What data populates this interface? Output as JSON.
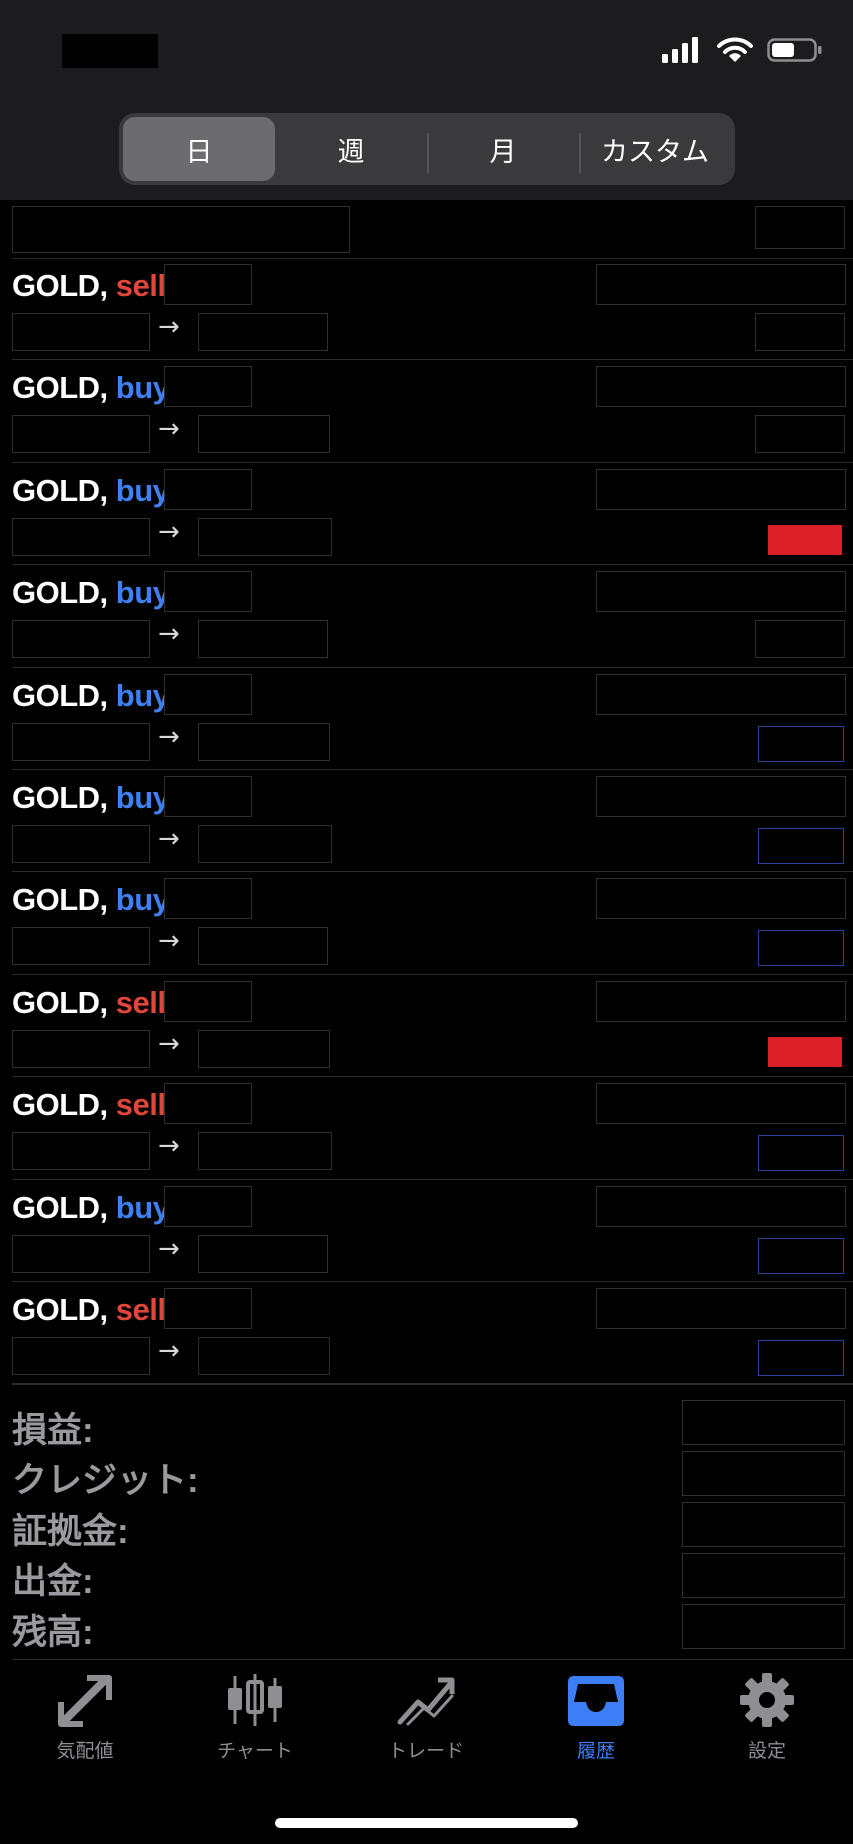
{
  "segmented": {
    "options": [
      "日",
      "週",
      "月",
      "カスタム"
    ],
    "selected": "日"
  },
  "trades": [
    {
      "symbol": "GOLD,",
      "side": "sell",
      "profit_indicator": "neutral"
    },
    {
      "symbol": "GOLD,",
      "side": "buy",
      "profit_indicator": "neutral"
    },
    {
      "symbol": "GOLD,",
      "side": "buy",
      "profit_indicator": "red"
    },
    {
      "symbol": "GOLD,",
      "side": "buy",
      "profit_indicator": "neutral"
    },
    {
      "symbol": "GOLD,",
      "side": "buy",
      "profit_indicator": "blue"
    },
    {
      "symbol": "GOLD,",
      "side": "buy",
      "profit_indicator": "blue"
    },
    {
      "symbol": "GOLD,",
      "side": "buy",
      "profit_indicator": "blue"
    },
    {
      "symbol": "GOLD,",
      "side": "sell",
      "profit_indicator": "red"
    },
    {
      "symbol": "GOLD,",
      "side": "sell",
      "profit_indicator": "blue"
    },
    {
      "symbol": "GOLD,",
      "side": "buy",
      "profit_indicator": "blue"
    },
    {
      "symbol": "GOLD,",
      "side": "sell",
      "profit_indicator": "blue"
    }
  ],
  "arrow_glyph": "→",
  "summary": {
    "labels": [
      "損益:",
      "クレジット:",
      "証拠金:",
      "出金:",
      "残高:"
    ]
  },
  "tabbar": {
    "items": [
      {
        "label": "気配値",
        "icon": "quotes-arrows-icon",
        "active": false
      },
      {
        "label": "チャート",
        "icon": "candlestick-chart-icon",
        "active": false
      },
      {
        "label": "トレード",
        "icon": "trade-trend-icon",
        "active": false
      },
      {
        "label": "履歴",
        "icon": "history-inbox-icon",
        "active": true
      },
      {
        "label": "設定",
        "icon": "settings-gear-icon",
        "active": false
      }
    ]
  },
  "colors": {
    "sell": "#e0463b",
    "buy": "#3f7ff0",
    "active_tab": "#3d7df5",
    "loss_indicator": "#dc1f26"
  }
}
